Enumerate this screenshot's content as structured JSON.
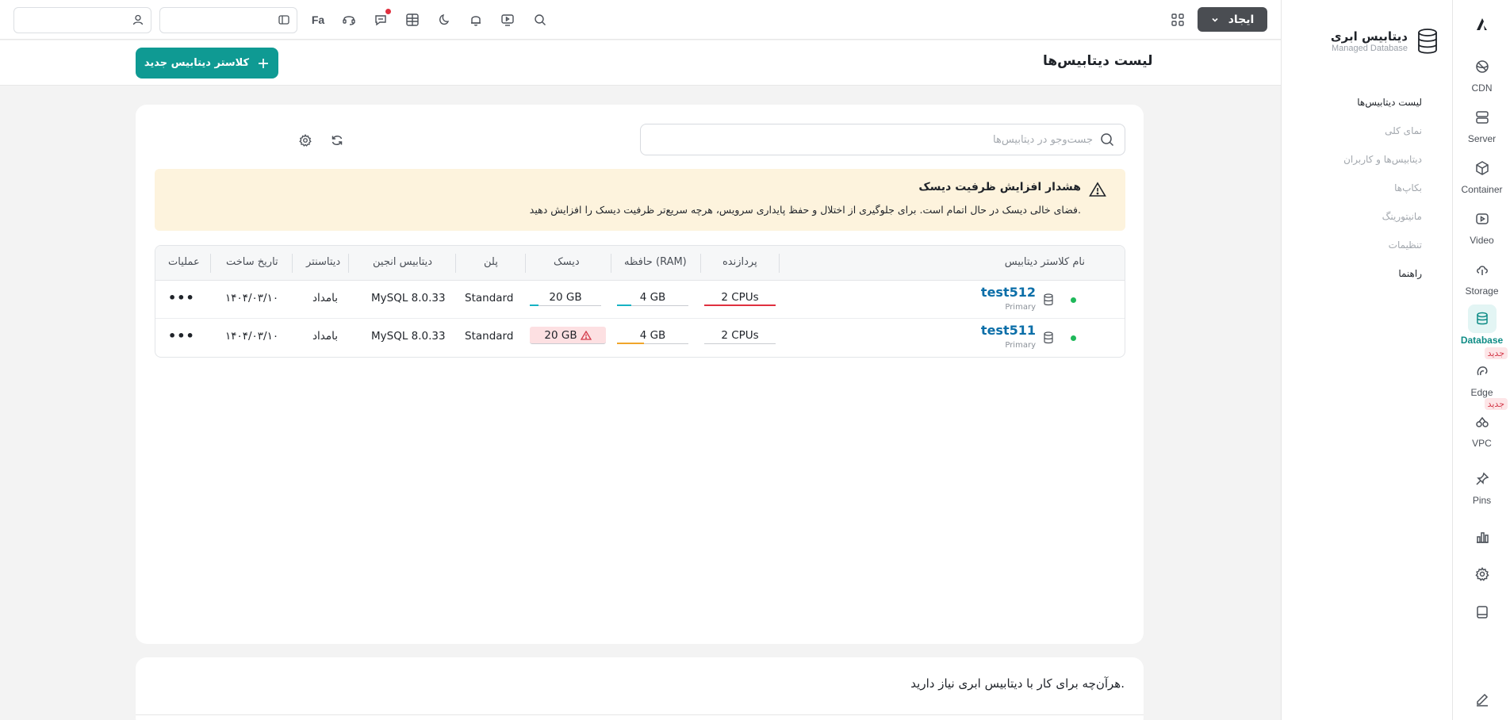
{
  "rail": {
    "items": [
      {
        "label": "CDN",
        "icon": "cdn-icon"
      },
      {
        "label": "Server",
        "icon": "server-icon"
      },
      {
        "label": "Container",
        "icon": "container-icon"
      },
      {
        "label": "Video",
        "icon": "video-icon"
      },
      {
        "label": "Storage",
        "icon": "storage-icon"
      },
      {
        "label": "Database",
        "icon": "database-icon",
        "active": true
      },
      {
        "label": "Edge",
        "icon": "edge-icon",
        "badge": "جدید"
      },
      {
        "label": "VPC",
        "icon": "vpc-icon",
        "badge": "جدید"
      },
      {
        "label": "Pins",
        "icon": "pin-icon"
      }
    ],
    "accent": "#0f9a93"
  },
  "subnav": {
    "title": "دیتابیس ابری",
    "subtitle": "Managed Database",
    "items": [
      "لیست دیتابیس‌ها",
      "نمای کلی",
      "دیتابیس‌ها و کاربران",
      "بکاپ‌ها",
      "مانیتورینگ",
      "تنظیمات",
      "راهنما"
    ]
  },
  "topbar": {
    "create_label": "ایجاد",
    "lang": "Fa"
  },
  "header": {
    "title": "لیست دیتابیس‌ها",
    "new_cluster_label": "کلاستر دیتابیس جدید"
  },
  "search": {
    "placeholder": "جست‌وجو در دیتابیس‌ها"
  },
  "alert": {
    "title": "هشدار افزایش ظرفیت دیسک",
    "text": "فضای خالی دیسک در حال اتمام است. برای جلوگیری از اختلال و حفظ پایداری سرویس، هرچه سریع‌تر ظرفیت دیسک را افزایش دهید."
  },
  "table": {
    "headers": {
      "name": "نام کلاستر دیتابیس",
      "cpu": "پردازنده",
      "ram": "حافظه (RAM)",
      "disk": "دیسک",
      "plan": "پلن",
      "engine": "دیتابیس انجین",
      "datacenter": "دیتاسنتر",
      "created": "تاریخ ساخت",
      "actions": "عملیات"
    },
    "rows": [
      {
        "name": "test512",
        "role": "Primary",
        "cpu": "2 CPUs",
        "ram": "4 GB",
        "disk": "20 GB",
        "plan": "Standard",
        "engine": "MySQL 8.0.33",
        "datacenter": "بامداد",
        "created": "۱۴۰۴/۰۳/۱۰",
        "actions": "•••",
        "disk_warning": false,
        "cpu_usage": 1.0,
        "ram_usage": 0.2,
        "disk_usage": 0.12
      },
      {
        "name": "test511",
        "role": "Primary",
        "cpu": "2 CPUs",
        "ram": "4 GB",
        "disk": "20 GB",
        "plan": "Standard",
        "engine": "MySQL 8.0.33",
        "datacenter": "بامداد",
        "created": "۱۴۰۴/۰۳/۱۰",
        "actions": "•••",
        "disk_warning": true,
        "cpu_usage": 0.0,
        "ram_usage": 0.38,
        "disk_usage": 0.0
      }
    ]
  },
  "footer_card": {
    "title": "هرآن‌چه برای کار با دیتابیس ابری نیاز دارید."
  }
}
